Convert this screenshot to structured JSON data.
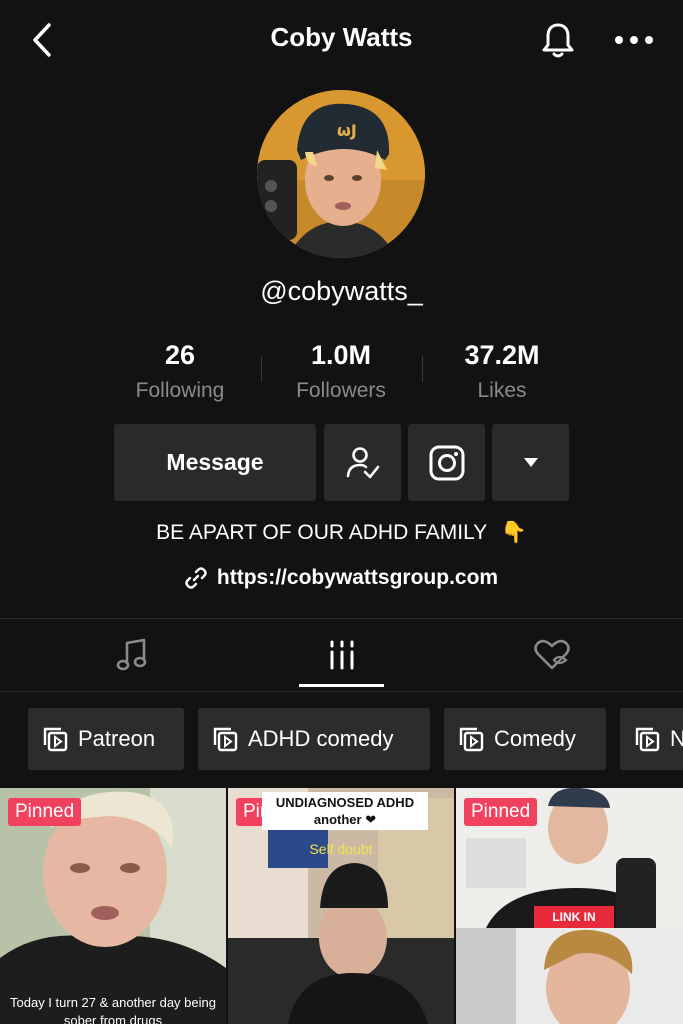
{
  "header": {
    "title": "Coby Watts",
    "back_icon": "chevron-left-icon",
    "bell_icon": "bell-icon",
    "more_icon": "more-horizontal-icon"
  },
  "profile": {
    "username": "@cobywatts_",
    "stats": [
      {
        "value": "26",
        "label": "Following"
      },
      {
        "value": "1.0M",
        "label": "Followers"
      },
      {
        "value": "37.2M",
        "label": "Likes"
      }
    ],
    "message_label": "Message",
    "bio": "BE APART OF OUR ADHD FAMILY",
    "bio_emoji": "👇",
    "link": "https://cobywattsgroup.com"
  },
  "tabs": [
    "music-note-icon",
    "grid-icon",
    "liked-hidden-icon"
  ],
  "playlists": [
    "Patreon",
    "ADHD comedy",
    "Comedy",
    "N"
  ],
  "videos": [
    {
      "badge": "Pinned",
      "caption": "Today I turn 27 & another day being sober from drugs"
    },
    {
      "badge": "Pinned",
      "caption_top": "UNDIAGNOSED ADHD",
      "caption_top2": "another ❤",
      "caption_mid": "Self doubt"
    },
    {
      "badge": "Pinned",
      "overlay": "LINK IN"
    }
  ],
  "colors": {
    "background": "#121212",
    "button": "#2a2a2a",
    "pinned": "#f0425f",
    "muted_text": "#8a8a8a"
  }
}
